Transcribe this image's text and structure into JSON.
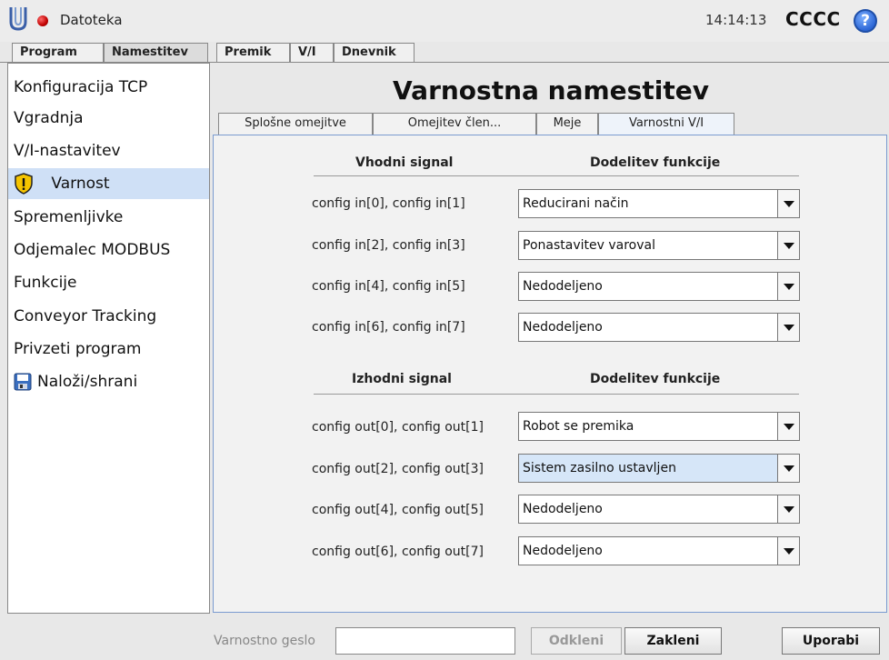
{
  "header": {
    "menu_label": "Datoteka",
    "time": "14:14:13",
    "robot_name": "CCCC",
    "help_symbol": "?"
  },
  "top_tabs": [
    {
      "label": "Program",
      "active": false
    },
    {
      "label": "Namestitev",
      "active": true
    },
    {
      "label": "Premik",
      "active": false
    },
    {
      "label": "V/I",
      "active": false
    },
    {
      "label": "Dnevnik",
      "active": false
    }
  ],
  "sidebar": {
    "items": [
      {
        "label": "Konfiguracija TCP",
        "icon": ""
      },
      {
        "label": "Vgradnja",
        "icon": ""
      },
      {
        "label": "V/I-nastavitev",
        "icon": ""
      },
      {
        "label": "Varnost",
        "icon": "warning-shield-icon",
        "selected": true
      },
      {
        "label": "Spremenljivke",
        "icon": ""
      },
      {
        "label": "Odjemalec MODBUS",
        "icon": ""
      },
      {
        "label": "Funkcije",
        "icon": ""
      },
      {
        "label": "Conveyor Tracking",
        "icon": ""
      },
      {
        "label": "Privzeti program",
        "icon": ""
      },
      {
        "label": "Naloži/shrani",
        "icon": "floppy-disk-icon"
      }
    ]
  },
  "main": {
    "title": "Varnostna namestitev",
    "sub_tabs": [
      {
        "label": "Splošne omejitve",
        "active": false
      },
      {
        "label": "Omejitev člen...",
        "active": false
      },
      {
        "label": "Meje",
        "active": false
      },
      {
        "label": "Varnostni V/I",
        "active": true
      }
    ],
    "inputs": {
      "col_signal": "Vhodni signal",
      "col_function": "Dodelitev funkcije",
      "rows": [
        {
          "signal": "config in[0], config in[1]",
          "function": "Reducirani način"
        },
        {
          "signal": "config in[2], config in[3]",
          "function": "Ponastavitev varoval"
        },
        {
          "signal": "config in[4], config in[5]",
          "function": "Nedodeljeno"
        },
        {
          "signal": "config in[6], config in[7]",
          "function": "Nedodeljeno"
        }
      ]
    },
    "outputs": {
      "col_signal": "Izhodni signal",
      "col_function": "Dodelitev funkcije",
      "rows": [
        {
          "signal": "config out[0], config out[1]",
          "function": "Robot se premika"
        },
        {
          "signal": "config out[2], config out[3]",
          "function": "Sistem zasilno ustavljen"
        },
        {
          "signal": "config out[4], config out[5]",
          "function": "Nedodeljeno"
        },
        {
          "signal": "config out[6], config out[7]",
          "function": "Nedodeljeno"
        }
      ]
    }
  },
  "footer": {
    "password_label": "Varnostno geslo",
    "password_value": "",
    "unlock_label": "Odkleni",
    "lock_label": "Zakleni",
    "apply_label": "Uporabi"
  },
  "colors": {
    "selection": "#cfe0f6",
    "content_border": "#7a9bd0",
    "highlight_dropdown": "#d6e6f8"
  }
}
